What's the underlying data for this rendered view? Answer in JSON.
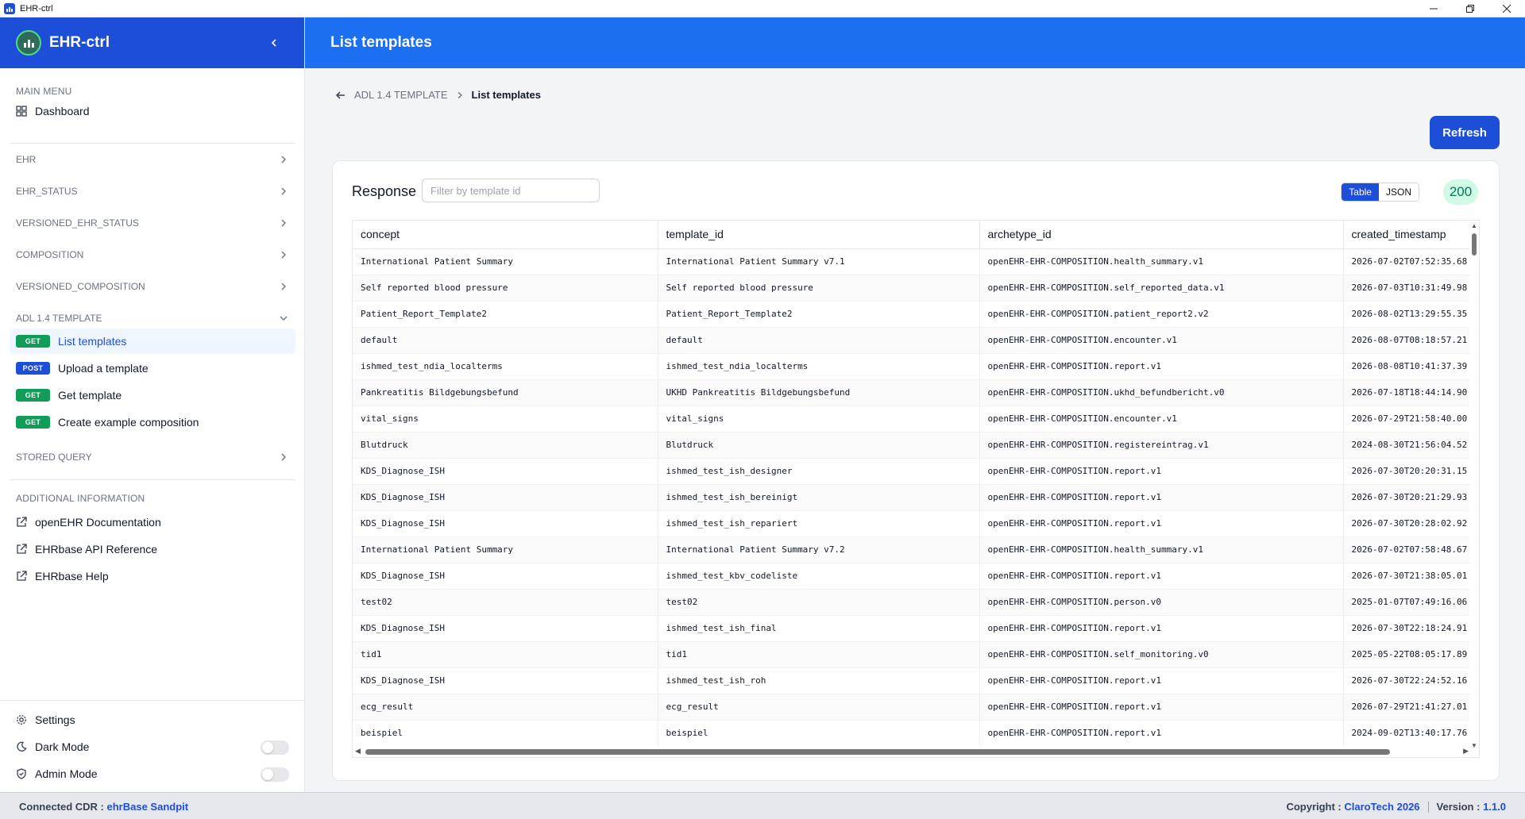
{
  "window": {
    "title": "EHR-ctrl"
  },
  "sidebar": {
    "brand": "EHR-ctrl",
    "main_menu_label": "MAIN MENU",
    "dashboard_label": "Dashboard",
    "groups": [
      {
        "label": "EHR"
      },
      {
        "label": "EHR_STATUS"
      },
      {
        "label": "VERSIONED_EHR_STATUS"
      },
      {
        "label": "COMPOSITION"
      },
      {
        "label": "VERSIONED_COMPOSITION"
      },
      {
        "label": "ADL 1.4 TEMPLATE"
      }
    ],
    "endpoints": [
      {
        "method": "GET",
        "label": "List templates"
      },
      {
        "method": "POST",
        "label": "Upload a template"
      },
      {
        "method": "GET",
        "label": "Get template"
      },
      {
        "method": "GET",
        "label": "Create example composition"
      }
    ],
    "stored_query_label": "STORED QUERY",
    "additional_label": "ADDITIONAL INFORMATION",
    "links": [
      {
        "label": "openEHR Documentation"
      },
      {
        "label": "EHRbase API Reference"
      },
      {
        "label": "EHRbase Help"
      }
    ],
    "footer": {
      "settings_label": "Settings",
      "dark_mode_label": "Dark Mode",
      "admin_mode_label": "Admin Mode",
      "dark_mode_on": false,
      "admin_mode_on": false
    }
  },
  "header": {
    "title": "List templates"
  },
  "breadcrumb": {
    "parent": "ADL 1.4 TEMPLATE",
    "current": "List templates"
  },
  "refresh_label": "Refresh",
  "response": {
    "label": "Response",
    "filter_placeholder": "Filter by template id",
    "filter_value": "",
    "view_options": [
      "Table",
      "JSON"
    ],
    "selected_view": "Table",
    "status_code": "200"
  },
  "table": {
    "columns": [
      "concept",
      "template_id",
      "archetype_id",
      "created_timestamp"
    ],
    "rows": [
      [
        "International Patient Summary",
        "International Patient Summary v7.1",
        "openEHR-EHR-COMPOSITION.health_summary.v1",
        "2026-07-02T07:52:35.68"
      ],
      [
        "Self reported blood pressure",
        "Self reported blood pressure",
        "openEHR-EHR-COMPOSITION.self_reported_data.v1",
        "2026-07-03T10:31:49.98"
      ],
      [
        "Patient_Report_Template2",
        "Patient_Report_Template2",
        "openEHR-EHR-COMPOSITION.patient_report2.v2",
        "2026-08-02T13:29:55.35"
      ],
      [
        "default",
        "default",
        "openEHR-EHR-COMPOSITION.encounter.v1",
        "2026-08-07T08:18:57.21"
      ],
      [
        "ishmed_test_ndia_localterms",
        "ishmed_test_ndia_localterms",
        "openEHR-EHR-COMPOSITION.report.v1",
        "2026-08-08T10:41:37.39"
      ],
      [
        "Pankreatitis Bildgebungsbefund",
        "UKHD Pankreatitis Bildgebungsbefund",
        "openEHR-EHR-COMPOSITION.ukhd_befundbericht.v0",
        "2026-07-18T18:44:14.90"
      ],
      [
        "vital_signs",
        "vital_signs",
        "openEHR-EHR-COMPOSITION.encounter.v1",
        "2026-07-29T21:58:40.00"
      ],
      [
        "Blutdruck",
        "Blutdruck",
        "openEHR-EHR-COMPOSITION.registereintrag.v1",
        "2024-08-30T21:56:04.52"
      ],
      [
        "KDS_Diagnose_ISH",
        "ishmed_test_ish_designer",
        "openEHR-EHR-COMPOSITION.report.v1",
        "2026-07-30T20:20:31.15"
      ],
      [
        "KDS_Diagnose_ISH",
        "ishmed_test_ish_bereinigt",
        "openEHR-EHR-COMPOSITION.report.v1",
        "2026-07-30T20:21:29.93"
      ],
      [
        "KDS_Diagnose_ISH",
        "ishmed_test_ish_repariert",
        "openEHR-EHR-COMPOSITION.report.v1",
        "2026-07-30T20:28:02.92"
      ],
      [
        "International Patient Summary",
        "International Patient Summary v7.2",
        "openEHR-EHR-COMPOSITION.health_summary.v1",
        "2026-07-02T07:58:48.67"
      ],
      [
        "KDS_Diagnose_ISH",
        "ishmed_test_kbv_codeliste",
        "openEHR-EHR-COMPOSITION.report.v1",
        "2026-07-30T21:38:05.01"
      ],
      [
        "test02",
        "test02",
        "openEHR-EHR-COMPOSITION.person.v0",
        "2025-01-07T07:49:16.06"
      ],
      [
        "KDS_Diagnose_ISH",
        "ishmed_test_ish_final",
        "openEHR-EHR-COMPOSITION.report.v1",
        "2026-07-30T22:18:24.91"
      ],
      [
        "tid1",
        "tid1",
        "openEHR-EHR-COMPOSITION.self_monitoring.v0",
        "2025-05-22T08:05:17.89"
      ],
      [
        "KDS_Diagnose_ISH",
        "ishmed_test_ish_roh",
        "openEHR-EHR-COMPOSITION.report.v1",
        "2026-07-30T22:24:52.16"
      ],
      [
        "ecg_result",
        "ecg_result",
        "openEHR-EHR-COMPOSITION.report.v1",
        "2026-07-29T21:41:27.01"
      ],
      [
        "beispiel",
        "beispiel",
        "openEHR-EHR-COMPOSITION.report.v1",
        "2024-09-02T13:40:17.76"
      ]
    ]
  },
  "statusbar": {
    "connected_label": "Connected CDR :",
    "connected_value": "ehrBase Sandpit",
    "copyright_label": "Copyright :",
    "copyright_value": "ClaroTech 2026",
    "version_label": "Version :",
    "version_value": "1.1.0"
  },
  "colors": {
    "primary": "#1d4ed8",
    "header_blue": "#1d6ff2",
    "get_badge": "#0f9d58",
    "post_badge": "#1d4ed8",
    "status_ok_bg": "#d1fae5",
    "status_ok_text": "#047857"
  },
  "icons": {
    "app": "app-logo-icon",
    "collapse": "chevron-left-icon",
    "dashboard": "grid-icon",
    "group_chevron": "chevron-right-icon",
    "group_open": "chevron-down-icon",
    "back": "arrow-left-icon",
    "breadcrumb_sep": "chevron-right-icon",
    "external": "external-link-icon",
    "settings": "gear-icon",
    "dark_mode": "moon-icon",
    "admin_mode": "shield-check-icon"
  }
}
